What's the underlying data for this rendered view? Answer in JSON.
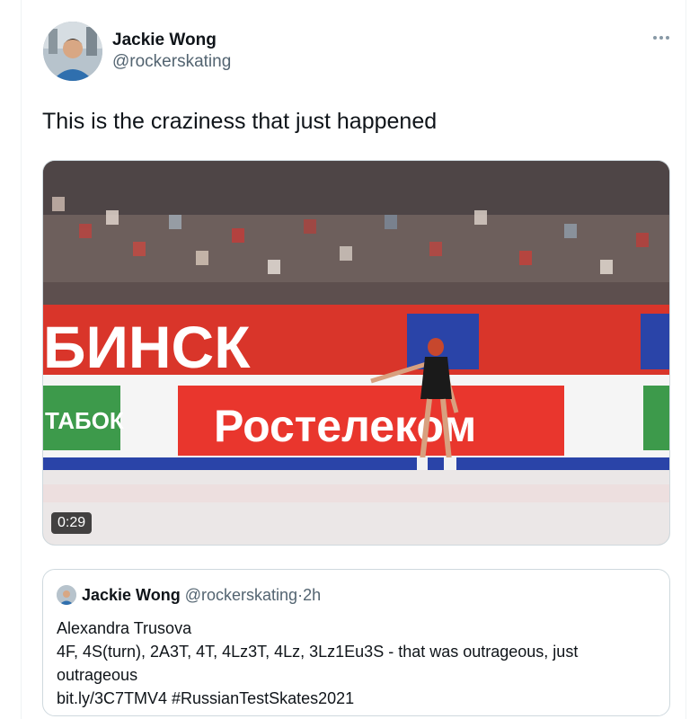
{
  "author": {
    "display_name": "Jackie Wong",
    "handle": "@rockerskating"
  },
  "tweet": {
    "text": "This is the craziness that just happened",
    "more_icon": "more-horizontal-icon"
  },
  "media": {
    "duration": "0:29",
    "banner_left_text": "БИНСК",
    "board_left_text": "ТАБОК",
    "board_main_text": "Ростелеком"
  },
  "quoted_tweet": {
    "display_name": "Jackie Wong",
    "handle": "@rockerskating",
    "separator": "·",
    "time": "2h",
    "lines": [
      "Alexandra Trusova",
      "4F, 4S(turn), 2A3T, 4T, 4Lz3T, 4Lz, 3Lz1Eu3S - that was outrageous, just",
      "outrageous",
      "bit.ly/3C7TMV4 #RussianTestSkates2021"
    ]
  },
  "colors": {
    "text_primary": "#0f1419",
    "text_secondary": "#536471",
    "border": "#cfd9de",
    "banner_red": "#d9352a",
    "rink_blue": "#2a44a8"
  }
}
